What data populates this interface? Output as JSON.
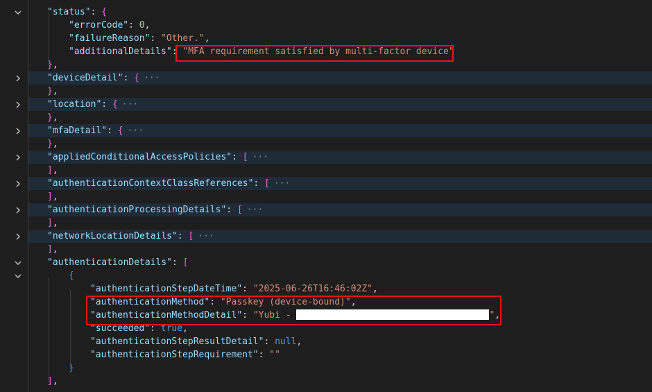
{
  "editor": {
    "lines": [
      {
        "fold": "expanded",
        "indent": 1,
        "segments": [
          [
            "k",
            "\"status\""
          ],
          [
            "p",
            ": "
          ],
          [
            "b1",
            "{"
          ]
        ]
      },
      {
        "indent": 2,
        "segments": [
          [
            "k",
            "\"errorCode\""
          ],
          [
            "p",
            ": "
          ],
          [
            "n",
            "0"
          ],
          [
            "p",
            ","
          ]
        ]
      },
      {
        "indent": 2,
        "segments": [
          [
            "k",
            "\"failureReason\""
          ],
          [
            "p",
            ": "
          ],
          [
            "s",
            "\"Other.\""
          ],
          [
            "p",
            ","
          ]
        ]
      },
      {
        "indent": 2,
        "segments": [
          [
            "k",
            "\"additionalDetails\""
          ],
          [
            "p",
            ": "
          ],
          [
            "s",
            "\"MFA requirement satisfied by multi-factor device\""
          ]
        ]
      },
      {
        "indent": 1,
        "segments": [
          [
            "b1",
            "}"
          ],
          [
            "p",
            ","
          ]
        ]
      },
      {
        "fold": "collapsed",
        "indent": 1,
        "segments": [
          [
            "k",
            "\"deviceDetail\""
          ],
          [
            "p",
            ": "
          ],
          [
            "b1",
            "{"
          ]
        ],
        "ellipsis": "···"
      },
      {
        "indent": 1,
        "segments": [
          [
            "b1",
            "}"
          ],
          [
            "p",
            ","
          ]
        ]
      },
      {
        "fold": "collapsed",
        "indent": 1,
        "segments": [
          [
            "k",
            "\"location\""
          ],
          [
            "p",
            ": "
          ],
          [
            "b1",
            "{"
          ]
        ],
        "ellipsis": "···"
      },
      {
        "indent": 1,
        "segments": [
          [
            "b1",
            "}"
          ],
          [
            "p",
            ","
          ]
        ]
      },
      {
        "fold": "collapsed",
        "indent": 1,
        "segments": [
          [
            "k",
            "\"mfaDetail\""
          ],
          [
            "p",
            ": "
          ],
          [
            "b1",
            "{"
          ]
        ],
        "ellipsis": "···"
      },
      {
        "indent": 1,
        "segments": [
          [
            "b1",
            "}"
          ],
          [
            "p",
            ","
          ]
        ]
      },
      {
        "fold": "collapsed",
        "indent": 1,
        "segments": [
          [
            "k",
            "\"appliedConditionalAccessPolicies\""
          ],
          [
            "p",
            ": "
          ],
          [
            "b1",
            "["
          ]
        ],
        "ellipsis": "···"
      },
      {
        "indent": 1,
        "segments": [
          [
            "b1",
            "]"
          ],
          [
            "p",
            ","
          ]
        ]
      },
      {
        "fold": "collapsed",
        "indent": 1,
        "segments": [
          [
            "k",
            "\"authenticationContextClassReferences\""
          ],
          [
            "p",
            ": "
          ],
          [
            "b1",
            "["
          ]
        ],
        "ellipsis": "···"
      },
      {
        "indent": 1,
        "segments": [
          [
            "b1",
            "]"
          ],
          [
            "p",
            ","
          ]
        ]
      },
      {
        "fold": "collapsed",
        "indent": 1,
        "segments": [
          [
            "k",
            "\"authenticationProcessingDetails\""
          ],
          [
            "p",
            ": "
          ],
          [
            "b1",
            "["
          ]
        ],
        "ellipsis": "···"
      },
      {
        "indent": 1,
        "segments": [
          [
            "b1",
            "]"
          ],
          [
            "p",
            ","
          ]
        ]
      },
      {
        "fold": "collapsed",
        "indent": 1,
        "segments": [
          [
            "k",
            "\"networkLocationDetails\""
          ],
          [
            "p",
            ": "
          ],
          [
            "b1",
            "["
          ]
        ],
        "ellipsis": "···"
      },
      {
        "indent": 1,
        "segments": [
          [
            "b1",
            "]"
          ],
          [
            "p",
            ","
          ]
        ]
      },
      {
        "fold": "expanded",
        "indent": 1,
        "segments": [
          [
            "k",
            "\"authenticationDetails\""
          ],
          [
            "p",
            ": "
          ],
          [
            "b1",
            "["
          ]
        ]
      },
      {
        "fold": "expanded",
        "indent": 2,
        "segments": [
          [
            "b3",
            "{"
          ]
        ]
      },
      {
        "indent": 3,
        "segments": [
          [
            "k",
            "\"authenticationStepDateTime\""
          ],
          [
            "p",
            ": "
          ],
          [
            "s",
            "\"2025-06-26T16:46:02Z\""
          ],
          [
            "p",
            ","
          ]
        ]
      },
      {
        "indent": 3,
        "segments": [
          [
            "k",
            "\"authenticationMethod\""
          ],
          [
            "p",
            ": "
          ],
          [
            "s",
            "\"Passkey (device-bound)\""
          ],
          [
            "p",
            ","
          ]
        ]
      },
      {
        "indent": 3,
        "segments": [
          [
            "k",
            "\"authenticationMethodDetail\""
          ],
          [
            "p",
            ": "
          ],
          [
            "s",
            "\"Yubi - "
          ],
          [
            "redact",
            ""
          ],
          [
            "s",
            "\""
          ],
          [
            "p",
            ","
          ]
        ]
      },
      {
        "indent": 3,
        "segments": [
          [
            "k",
            "\"succeeded\""
          ],
          [
            "p",
            ": "
          ],
          [
            "kw",
            "true"
          ],
          [
            "p",
            ","
          ]
        ]
      },
      {
        "indent": 3,
        "segments": [
          [
            "k",
            "\"authenticationStepResultDetail\""
          ],
          [
            "p",
            ": "
          ],
          [
            "kw",
            "null"
          ],
          [
            "p",
            ","
          ]
        ]
      },
      {
        "indent": 3,
        "segments": [
          [
            "k",
            "\"authenticationStepRequirement\""
          ],
          [
            "p",
            ": "
          ],
          [
            "s",
            "\"\""
          ]
        ]
      },
      {
        "indent": 2,
        "segments": [
          [
            "b3",
            "}"
          ]
        ]
      },
      {
        "indent": 1,
        "segments": [
          [
            "b1",
            "]"
          ],
          [
            "p",
            ","
          ]
        ]
      }
    ]
  },
  "colors": {
    "highlight_border": "#e81123",
    "background": "#1e1e1e",
    "collapsed_line": "#1f2b37"
  }
}
